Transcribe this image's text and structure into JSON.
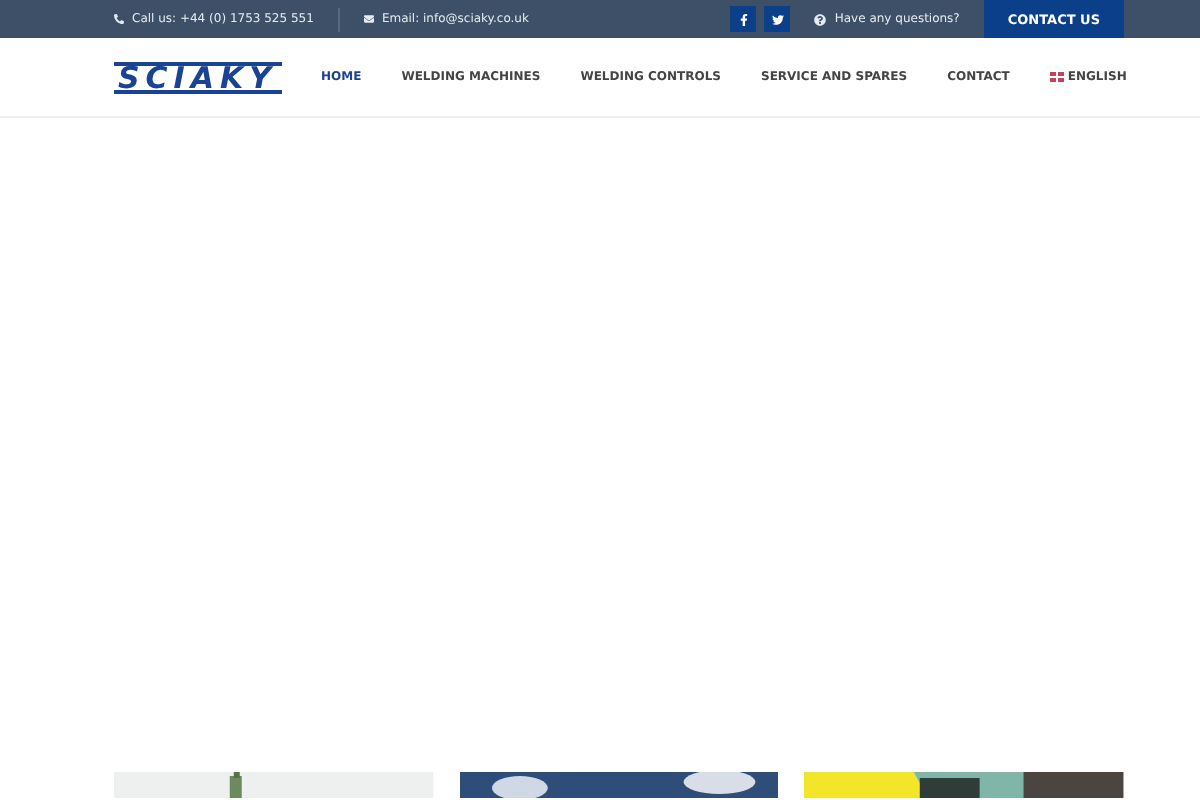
{
  "topbar": {
    "phone": "Call us: +44 (0) 1753 525 551",
    "email": "Email: info@sciaky.co.uk",
    "social": [
      {
        "kind": "facebook"
      },
      {
        "kind": "twitter"
      }
    ],
    "question": "Have any questions?",
    "contact_button": "CONTACT US"
  },
  "header": {
    "logo": "SCIAKY",
    "nav": [
      {
        "label": "HOME",
        "selected": true
      },
      {
        "label": "WELDING MACHINES",
        "selected": false
      },
      {
        "label": "WELDING CONTROLS",
        "selected": false
      },
      {
        "label": "SERVICE AND SPARES",
        "selected": false
      },
      {
        "label": "CONTACT",
        "selected": false
      }
    ],
    "language": "ENGLISH"
  }
}
